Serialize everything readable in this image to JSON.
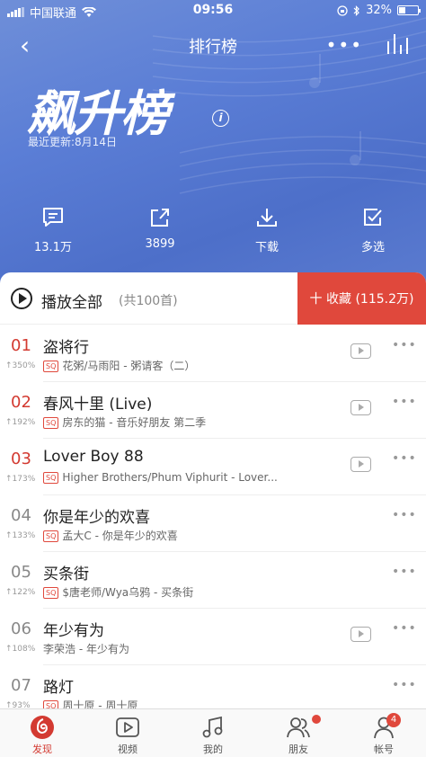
{
  "status_bar": {
    "carrier": "中国联通",
    "time": "09:56",
    "battery": "32%"
  },
  "nav": {
    "title": "排行榜"
  },
  "header": {
    "big_title": "飙升榜",
    "updated": "最近更新:8月14日"
  },
  "actions": [
    {
      "label": "13.1万",
      "icon": "comment-icon"
    },
    {
      "label": "3899",
      "icon": "share-icon"
    },
    {
      "label": "下载",
      "icon": "download-icon"
    },
    {
      "label": "多选",
      "icon": "multiselect-icon"
    }
  ],
  "playall": {
    "label": "播放全部",
    "count": "(共100首)",
    "collect": "十 收藏 (115.2万)"
  },
  "songs": [
    {
      "rank": "01",
      "trend": "↑350%",
      "title": "盗将行",
      "sq": "SQ",
      "sub": "花粥/马雨阳 - 粥请客（二）",
      "mv": true
    },
    {
      "rank": "02",
      "trend": "↑192%",
      "title": "春风十里 (Live)",
      "sq": "SQ",
      "sub": "房东的猫 - 音乐好朋友 第二季",
      "mv": true
    },
    {
      "rank": "03",
      "trend": "↑173%",
      "title": "Lover Boy 88",
      "sq": "SQ",
      "sub": "Higher Brothers/Phum Viphurit - Lover...",
      "mv": true
    },
    {
      "rank": "04",
      "trend": "↑133%",
      "title": "你是年少的欢喜",
      "sq": "SQ",
      "sub": "孟大C - 你是年少的欢喜",
      "mv": false
    },
    {
      "rank": "05",
      "trend": "↑122%",
      "title": "买条街",
      "sq": "SQ",
      "sub": "$唐老师/Wya乌鸦 - 买条街",
      "mv": false
    },
    {
      "rank": "06",
      "trend": "↑108%",
      "title": "年少有为",
      "sq": "",
      "sub": "李荣浩 - 年少有为",
      "mv": true
    },
    {
      "rank": "07",
      "trend": "↑93%",
      "title": "路灯",
      "sq": "SQ",
      "sub": "周十原 - 周十原",
      "mv": false
    }
  ],
  "tabs": [
    {
      "label": "发现",
      "active": true
    },
    {
      "label": "视频"
    },
    {
      "label": "我的"
    },
    {
      "label": "朋友"
    },
    {
      "label": "帐号",
      "badge": "4"
    }
  ],
  "colors": {
    "accent": "#e0483c",
    "hero": "#5b7ed6"
  }
}
